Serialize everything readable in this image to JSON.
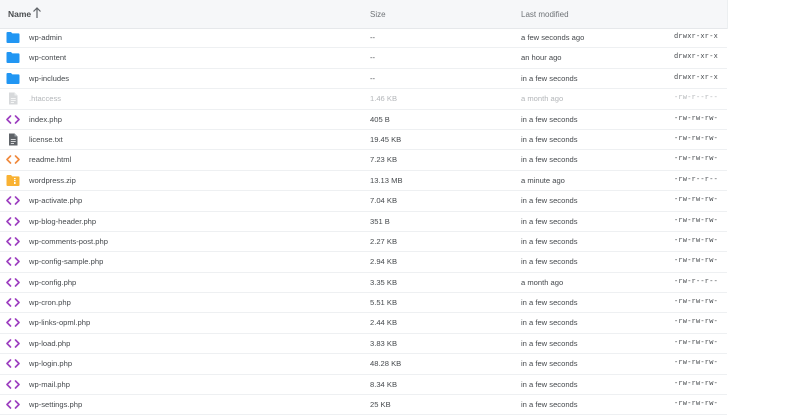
{
  "header": {
    "name": "Name",
    "size": "Size",
    "last_modified": "Last modified"
  },
  "files": [
    {
      "icon": "folder-icon",
      "name": "wp-admin",
      "size": "--",
      "modified": "a few seconds ago",
      "perm": "drwxr-xr-x"
    },
    {
      "icon": "folder-icon",
      "name": "wp-content",
      "size": "--",
      "modified": "an hour ago",
      "perm": "drwxr-xr-x"
    },
    {
      "icon": "folder-icon",
      "name": "wp-includes",
      "size": "--",
      "modified": "in a few seconds",
      "perm": "drwxr-xr-x"
    },
    {
      "icon": "file-icon",
      "name": ".htaccess",
      "size": "1.46 KB",
      "modified": "a month ago",
      "perm": "-rw-r--r--",
      "dim": true
    },
    {
      "icon": "code-icon",
      "name": "index.php",
      "size": "405 B",
      "modified": "in a few seconds",
      "perm": "-rw-rw-rw-"
    },
    {
      "icon": "file-icon",
      "name": "license.txt",
      "size": "19.45 KB",
      "modified": "in a few seconds",
      "perm": "-rw-rw-rw-"
    },
    {
      "icon": "html-code-icon",
      "name": "readme.html",
      "size": "7.23 KB",
      "modified": "in a few seconds",
      "perm": "-rw-rw-rw-"
    },
    {
      "icon": "zip-icon",
      "name": "wordpress.zip",
      "size": "13.13 MB",
      "modified": "a minute ago",
      "perm": "-rw-r--r--"
    },
    {
      "icon": "code-icon",
      "name": "wp-activate.php",
      "size": "7.04 KB",
      "modified": "in a few seconds",
      "perm": "-rw-rw-rw-"
    },
    {
      "icon": "code-icon",
      "name": "wp-blog-header.php",
      "size": "351 B",
      "modified": "in a few seconds",
      "perm": "-rw-rw-rw-"
    },
    {
      "icon": "code-icon",
      "name": "wp-comments-post.php",
      "size": "2.27 KB",
      "modified": "in a few seconds",
      "perm": "-rw-rw-rw-"
    },
    {
      "icon": "code-icon",
      "name": "wp-config-sample.php",
      "size": "2.94 KB",
      "modified": "in a few seconds",
      "perm": "-rw-rw-rw-"
    },
    {
      "icon": "code-icon",
      "name": "wp-config.php",
      "size": "3.35 KB",
      "modified": "a month ago",
      "perm": "-rw-r--r--"
    },
    {
      "icon": "code-icon",
      "name": "wp-cron.php",
      "size": "5.51 KB",
      "modified": "in a few seconds",
      "perm": "-rw-rw-rw-"
    },
    {
      "icon": "code-icon",
      "name": "wp-links-opml.php",
      "size": "2.44 KB",
      "modified": "in a few seconds",
      "perm": "-rw-rw-rw-"
    },
    {
      "icon": "code-icon",
      "name": "wp-load.php",
      "size": "3.83 KB",
      "modified": "in a few seconds",
      "perm": "-rw-rw-rw-"
    },
    {
      "icon": "code-icon",
      "name": "wp-login.php",
      "size": "48.28 KB",
      "modified": "in a few seconds",
      "perm": "-rw-rw-rw-"
    },
    {
      "icon": "code-icon",
      "name": "wp-mail.php",
      "size": "8.34 KB",
      "modified": "in a few seconds",
      "perm": "-rw-rw-rw-"
    },
    {
      "icon": "code-icon",
      "name": "wp-settings.php",
      "size": "25 KB",
      "modified": "in a few seconds",
      "perm": "-rw-rw-rw-"
    }
  ],
  "colors": {
    "folder": "#2196f3",
    "code": "#9c3dbf",
    "html_code": "#f0893c",
    "zip": "#f9b233",
    "file": "#5f6368"
  }
}
